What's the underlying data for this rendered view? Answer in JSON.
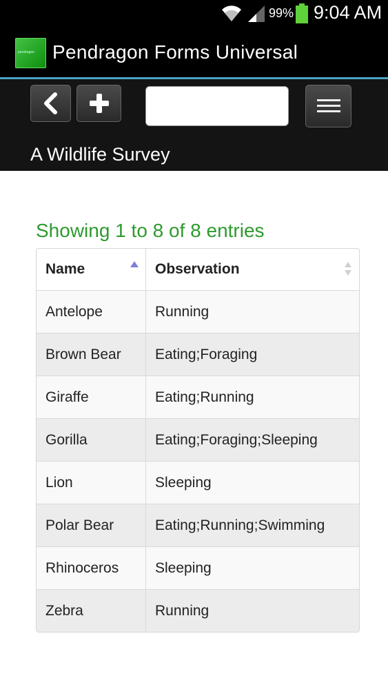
{
  "status_bar": {
    "battery_percent": "99%",
    "time": "9:04 AM",
    "icons": [
      "wifi-icon",
      "signal-icon",
      "battery-icon"
    ]
  },
  "app_bar": {
    "title": "Pendragon Forms Universal",
    "logo_text": "pendragon",
    "accent_color": "#4aa3c9"
  },
  "toolbar": {
    "back_icon": "chevron-left-icon",
    "add_icon": "plus-icon",
    "menu_icon": "hamburger-menu-icon",
    "search_value": "",
    "search_placeholder": ""
  },
  "form": {
    "title": "A Wildlife Survey"
  },
  "table": {
    "info": "Showing 1 to 8 of 8 entries",
    "info_color": "#2e9a2e",
    "columns": [
      "Name",
      "Observation"
    ],
    "sorted_column": "Name",
    "sort_direction": "ascending",
    "rows": [
      {
        "name": "Antelope",
        "observation": "Running"
      },
      {
        "name": "Brown Bear",
        "observation": "Eating;Foraging"
      },
      {
        "name": "Giraffe",
        "observation": "Eating;Running"
      },
      {
        "name": "Gorilla",
        "observation": "Eating;Foraging;Sleeping"
      },
      {
        "name": "Lion",
        "observation": "Sleeping"
      },
      {
        "name": "Polar Bear",
        "observation": "Eating;Running;Swimming"
      },
      {
        "name": "Rhinoceros",
        "observation": "Sleeping"
      },
      {
        "name": "Zebra",
        "observation": "Running"
      }
    ]
  }
}
